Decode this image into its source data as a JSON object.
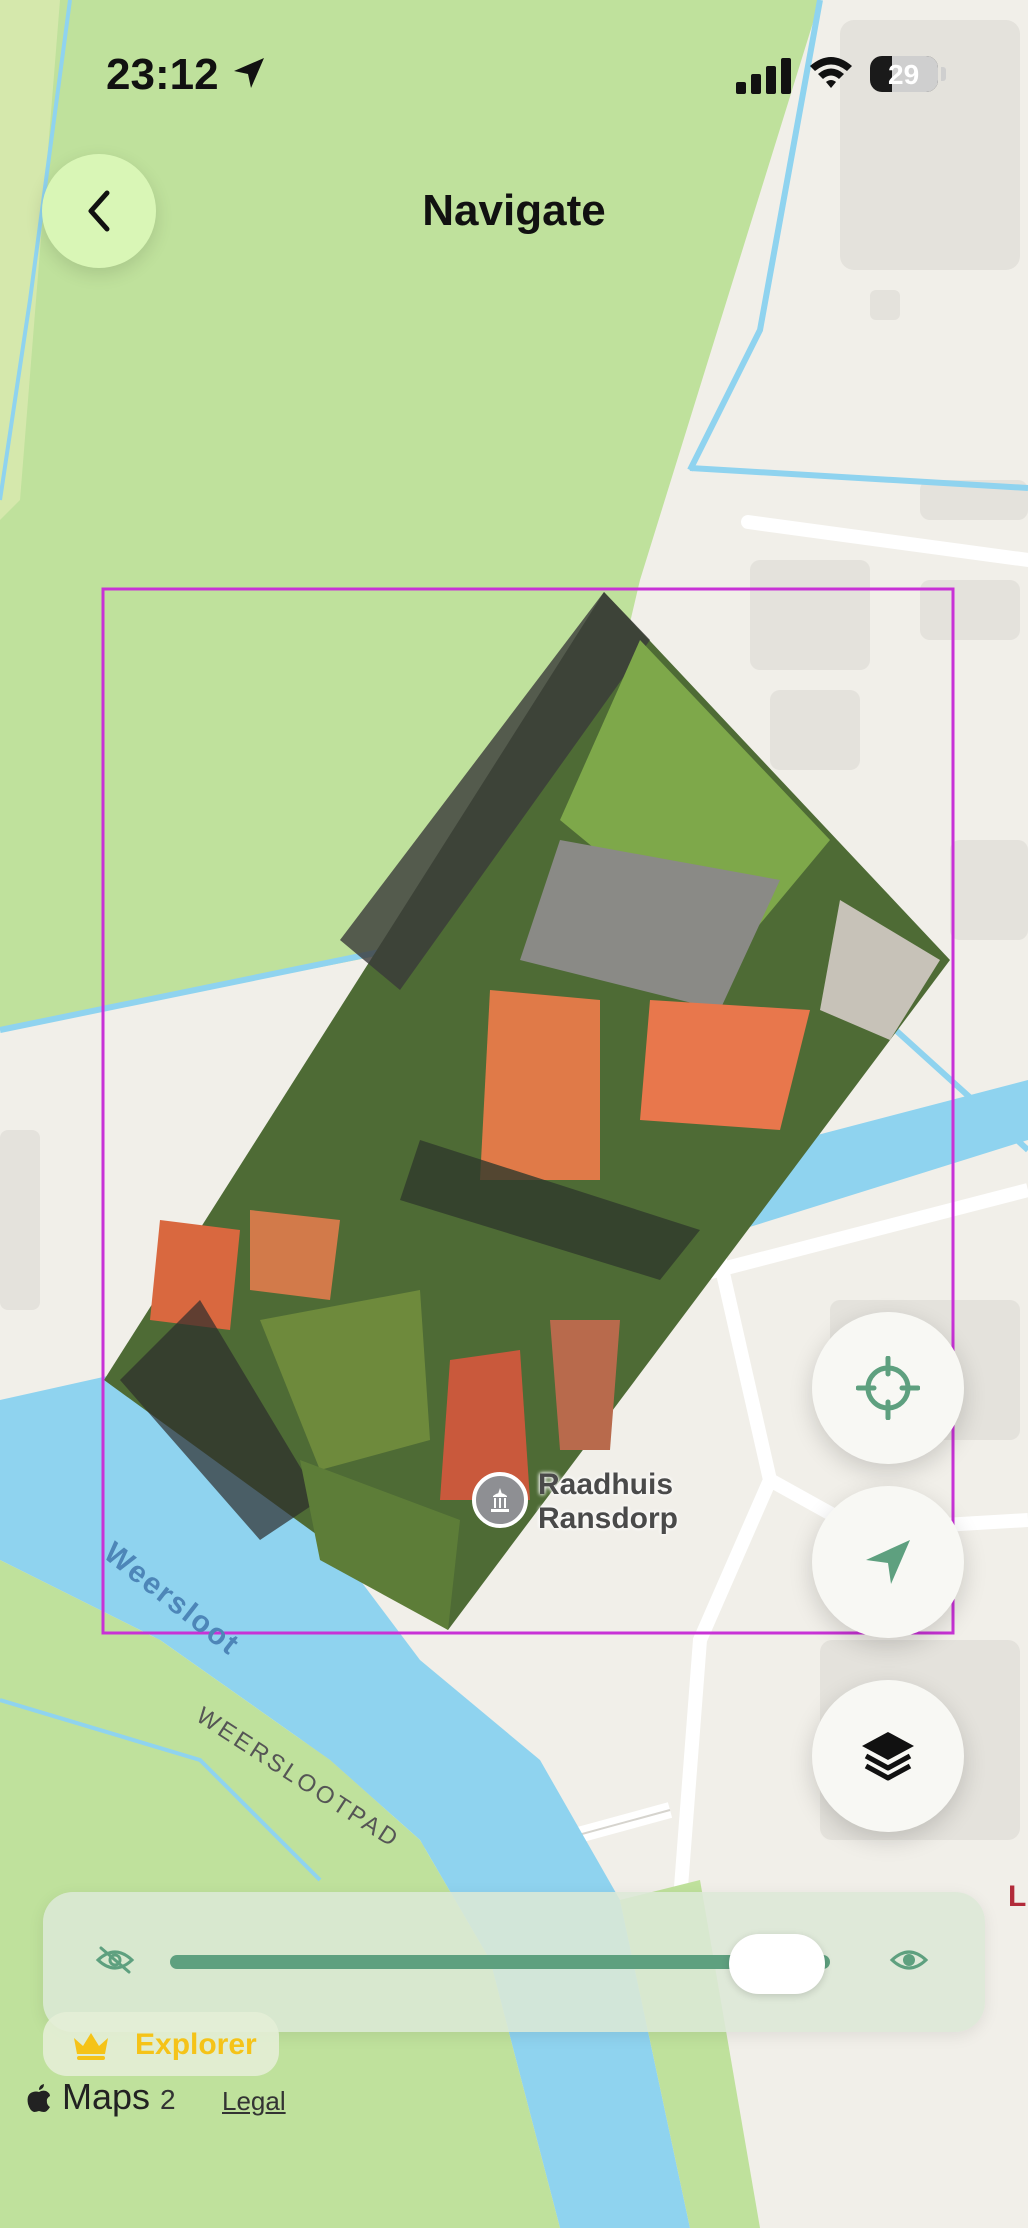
{
  "status_bar": {
    "time": "23:12",
    "battery": "29"
  },
  "header": {
    "title": "Navigate"
  },
  "map": {
    "poi_name_line1": "Raadhuis",
    "poi_name_line2": "Ransdorp",
    "water_label": "Weersloot",
    "road_label": "WEERSLOOTPAD",
    "edge_label": "L"
  },
  "controls": {
    "overlay_opacity": 0.92,
    "badge_label": "Explorer"
  },
  "attribution": {
    "maps": "Maps",
    "legal": "Legal",
    "number": "2"
  },
  "colors": {
    "grass": "#bfe19c",
    "water": "#8fd3ef",
    "land": "#f1efe9",
    "accent": "#5ea07f",
    "selection": "#c832d6",
    "badge": "#f5c318"
  },
  "icons": [
    "back-icon",
    "location-arrow-icon",
    "crosshair-icon",
    "navigation-icon",
    "layers-icon",
    "eye-off-icon",
    "eye-icon",
    "crown-icon",
    "town-hall-icon"
  ]
}
